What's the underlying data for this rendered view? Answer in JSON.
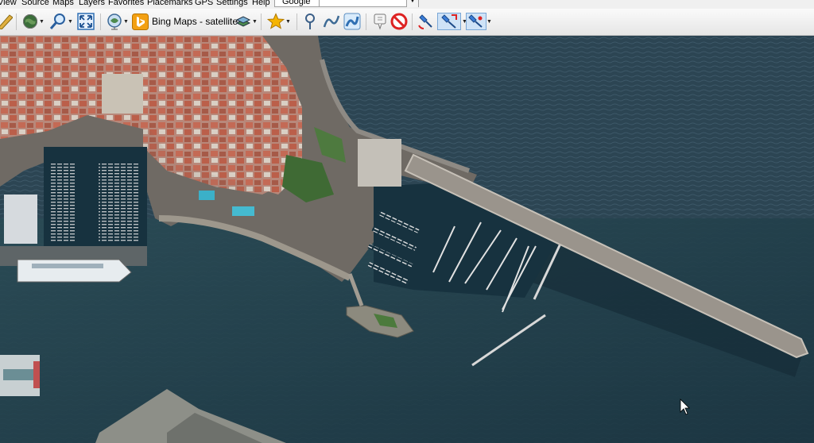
{
  "menu": {
    "items": [
      "View",
      "Source",
      "Maps",
      "Layers",
      "Favorites",
      "Placemarks",
      "GPS",
      "Settings",
      "Help"
    ]
  },
  "search": {
    "source": "Google",
    "value": ""
  },
  "toolbar": {
    "map_source_label": "Bing Maps - satellite",
    "icons": [
      "ruler-icon",
      "globe-icon",
      "zoom-icon",
      "fullscreen-icon",
      "map-source-icon",
      "layers-icon",
      "favorites-icon",
      "placemark-icon",
      "track-icon",
      "route-icon",
      "balloon-icon",
      "no-entry-icon",
      "gps-icon",
      "gps-active-icon",
      "gps-follow-icon"
    ]
  },
  "colors": {
    "sea": "#1f3a47",
    "toolbar": "#ececec",
    "accent": "#2f7dd1"
  }
}
